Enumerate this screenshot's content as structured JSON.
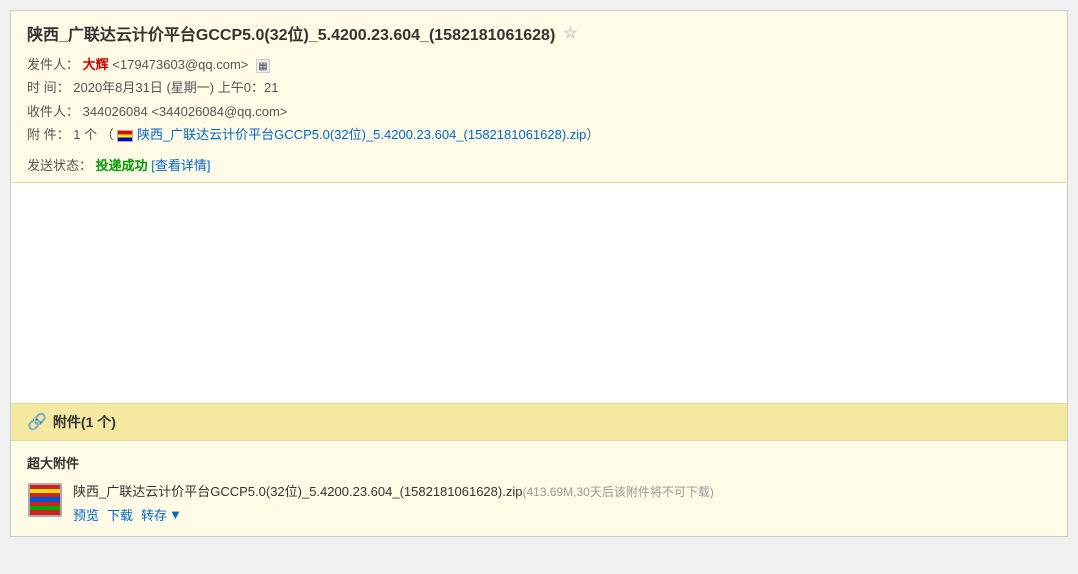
{
  "email": {
    "subject": "陕西_广联达云计价平台GCCP5.0(32位)_5.4200.23.604_(1582181061628)",
    "star_label": "☆",
    "sender_label": "发件人：",
    "sender_name": "大辉",
    "sender_email": "<179473603@qq.com>",
    "time_label": "时  间：",
    "time_value": "2020年8月31日 (星期一) 上午0：21",
    "recipient_label": "收件人：",
    "recipient_value": "344026084 <344026084@qq.com>",
    "attachment_label": "附  件：",
    "attachment_count": "1 个",
    "attachment_filename_short": "陕西_广联达云计价平台GCCP5.0(32位)_5.4200.23.604_(1582181061628).zip",
    "send_status_label": "发送状态：",
    "send_status_value": "投递成功",
    "send_status_detail": "[查看详情]",
    "attachment_section_title": "附件(1 个)",
    "attachment_type": "超大附件",
    "attachment_full_filename": "陕西_广联达云计价平台GCCP5.0(32位)_5.4200.23.604_(1582181061628).zip",
    "attachment_size": "(413.69M,30天后该附件将不可下载)",
    "action_preview": "预览",
    "action_download": "下载",
    "action_save": "转存",
    "action_save_arrow": "▼"
  }
}
